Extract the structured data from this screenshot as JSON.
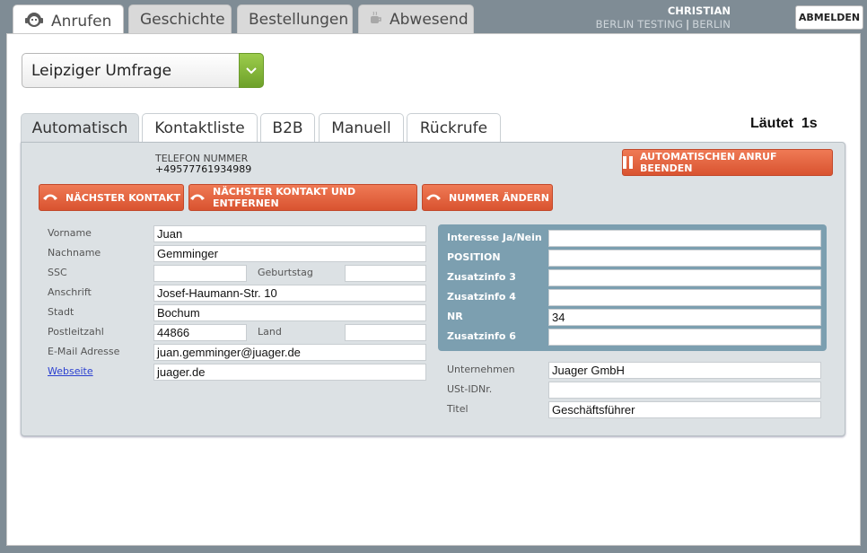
{
  "tabs": [
    {
      "label": "Anrufen",
      "icon": "agent-headset-icon"
    },
    {
      "label": "Geschichte"
    },
    {
      "label": "Bestellungen"
    },
    {
      "label": "Abwesend",
      "icon": "coffee-cup-icon"
    }
  ],
  "user": {
    "name": "CHRISTIAN",
    "team": "BERLIN TESTING",
    "separator": "|",
    "location": "BERLIN"
  },
  "logout_label": "ABMELDEN",
  "campaign": {
    "selected": "Leipziger Umfrage"
  },
  "subtabs": [
    "Automatisch",
    "Kontaktliste",
    "B2B",
    "Manuell",
    "Rückrufe"
  ],
  "call_status": {
    "label": "Läutet",
    "duration": "1s"
  },
  "phone": {
    "label": "TELEFON NUMMER",
    "value": "+49577761934989"
  },
  "buttons": {
    "end_auto_call": "AUTOMATISCHEN ANRUF BEENDEN",
    "next_contact": "NÄCHSTER KONTAKT",
    "next_contact_remove": "NÄCHSTER KONTAKT UND ENTFERNEN",
    "change_number": "NUMMER ÄNDERN"
  },
  "contact": {
    "vorname": {
      "label": "Vorname",
      "value": "Juan"
    },
    "nachname": {
      "label": "Nachname",
      "value": "Gemminger"
    },
    "ssc": {
      "label": "SSC",
      "value": ""
    },
    "geburtstag": {
      "label": "Geburtstag",
      "value": ""
    },
    "anschrift": {
      "label": "Anschrift",
      "value": "Josef-Haumann-Str. 10"
    },
    "stadt": {
      "label": "Stadt",
      "value": "Bochum"
    },
    "plz": {
      "label": "Postleitzahl",
      "value": "44866"
    },
    "land": {
      "label": "Land",
      "value": ""
    },
    "email": {
      "label": "E-Mail Adresse",
      "value": "juan.gemminger@juager.de"
    },
    "webseite": {
      "label": "Webseite",
      "value": "juager.de"
    }
  },
  "extra": [
    {
      "label": "Interesse Ja/Nein",
      "value": ""
    },
    {
      "label": "POSITION",
      "value": ""
    },
    {
      "label": "Zusatzinfo 3",
      "value": ""
    },
    {
      "label": "Zusatzinfo 4",
      "value": ""
    },
    {
      "label": "NR",
      "value": "34"
    },
    {
      "label": "Zusatzinfo 6",
      "value": ""
    }
  ],
  "company": {
    "unternehmen": {
      "label": "Unternehmen",
      "value": "Juager GmbH"
    },
    "ustid": {
      "label": "USt-IDNr.",
      "value": ""
    },
    "titel": {
      "label": "Titel",
      "value": "Geschäftsführer"
    }
  }
}
